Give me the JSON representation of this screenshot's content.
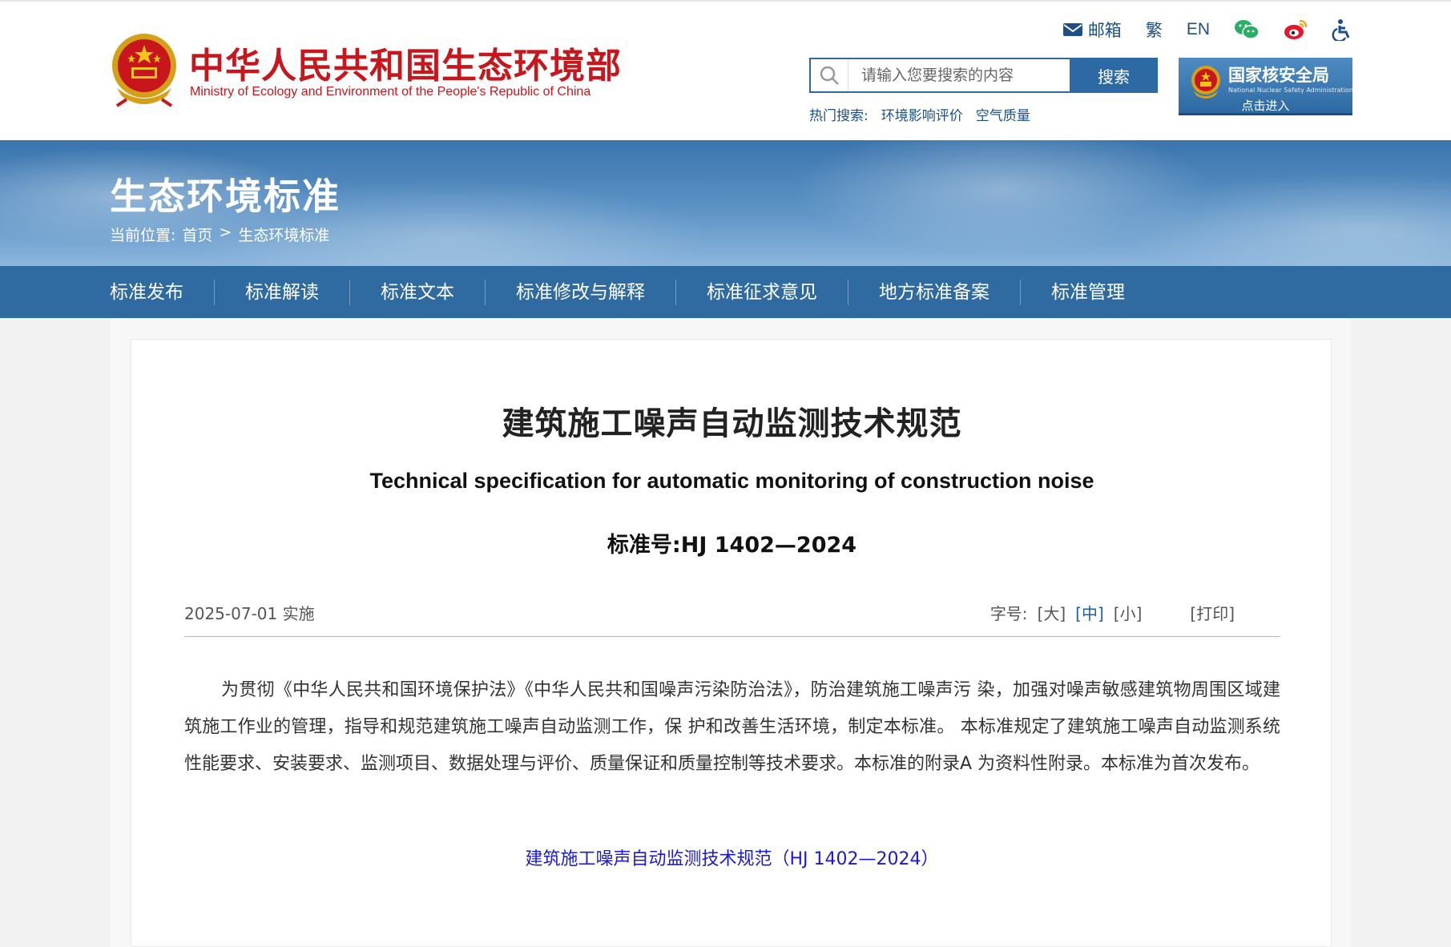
{
  "header": {
    "logo_cn": "中华人民共和国生态环境部",
    "logo_en": "Ministry of Ecology and Environment of the People's Republic of China",
    "toolbar": {
      "mail": "邮箱",
      "traditional": "繁",
      "english": "EN"
    },
    "search": {
      "placeholder": "请输入您要搜索的内容",
      "button": "搜索"
    },
    "hot_search": {
      "label": "热门搜索:",
      "items": [
        "环境影响评价",
        "空气质量"
      ]
    },
    "nnsa": {
      "title": "国家核安全局",
      "subtitle": "National Nuclear Safety Administration",
      "enter": "点击进入"
    }
  },
  "banner": {
    "title": "生态环境标准",
    "breadcrumb": {
      "label": "当前位置:",
      "home": "首页",
      "separator": ">",
      "current": "生态环境标准"
    }
  },
  "nav": {
    "items": [
      "标准发布",
      "标准解读",
      "标准文本",
      "标准修改与解释",
      "标准征求意见",
      "地方标准备案",
      "标准管理"
    ]
  },
  "article": {
    "title": "建筑施工噪声自动监测技术规范",
    "subtitle": "Technical specification for automatic monitoring of construction noise",
    "standard_number": "标准号:HJ 1402—2024",
    "date": "2025-07-01 实施",
    "font_size": {
      "label": "字号:",
      "large": "[大]",
      "medium": "[中]",
      "small": "[小]",
      "print": "[打印]"
    },
    "body": "为贯彻《中华人民共和国环境保护法》《中华人民共和国噪声污染防治法》，防治建筑施工噪声污 染，加强对噪声敏感建筑物周围区域建筑施工作业的管理，指导和规范建筑施工噪声自动监测工作，保 护和改善生活环境，制定本标准。 本标准规定了建筑施工噪声自动监测系统性能要求、安装要求、监测项目、数据处理与评价、质量保证和质量控制等技术要求。本标准的附录A 为资料性附录。本标准为首次发布。",
    "attachment_link": "建筑施工噪声自动监测技术规范（HJ 1402—2024）"
  },
  "colors": {
    "brand_red": "#c8161d",
    "nav_blue": "#2f6aa1",
    "link_blue": "#1a1ad6",
    "active_blue": "#1e5fa8"
  }
}
